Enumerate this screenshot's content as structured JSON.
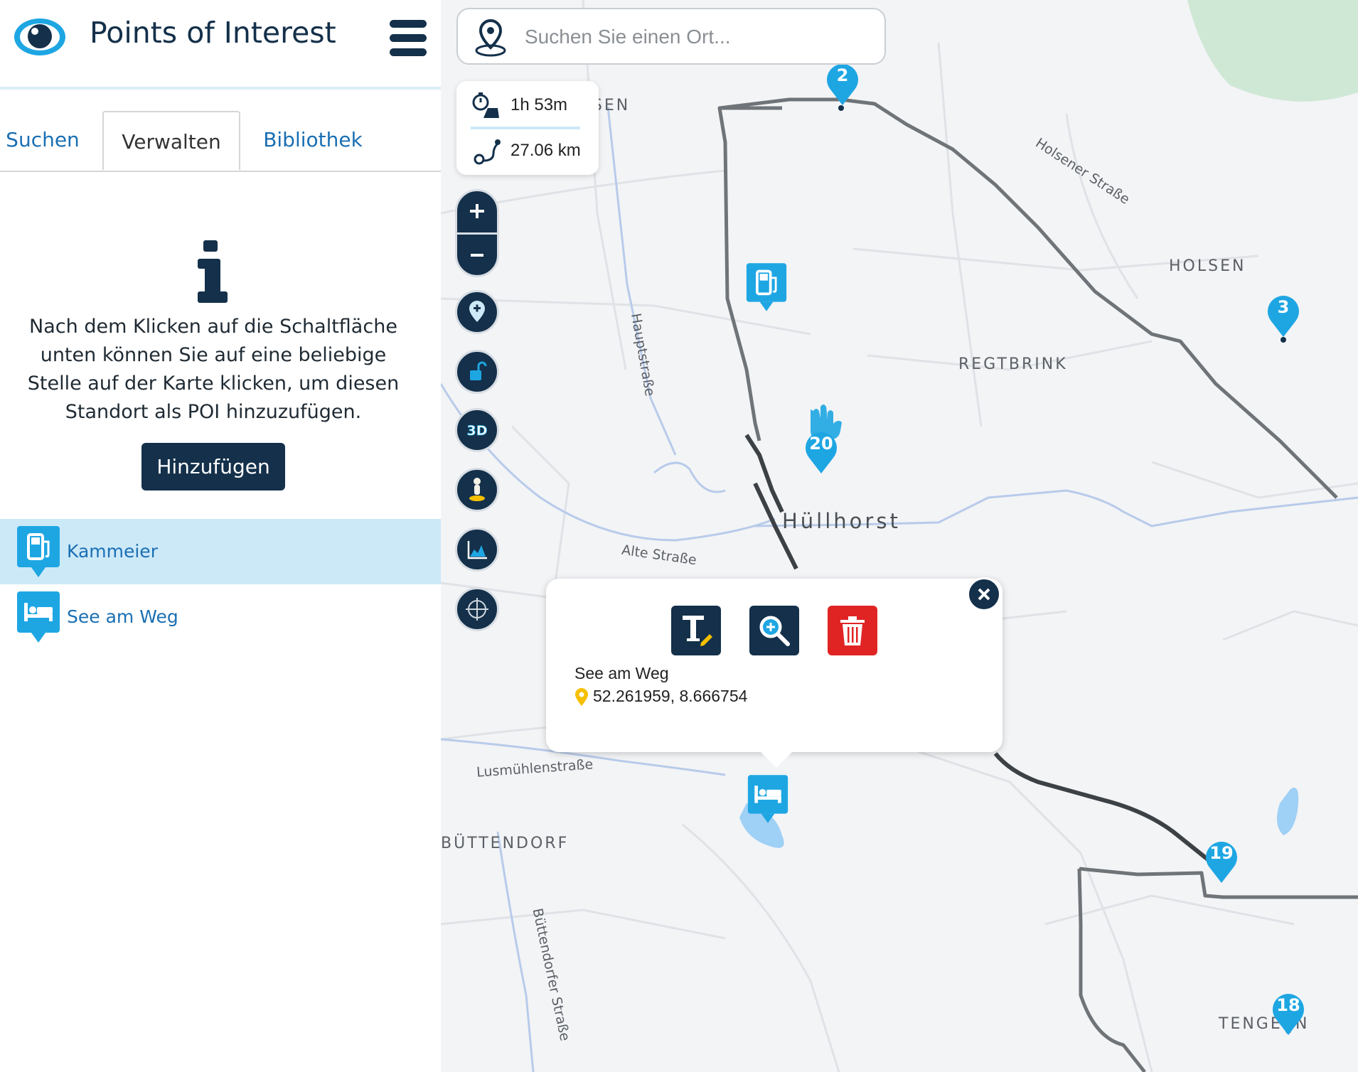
{
  "app": {
    "title": "Points of Interest"
  },
  "tabs": [
    {
      "label": "Suchen"
    },
    {
      "label": "Verwalten"
    },
    {
      "label": "Bibliothek"
    }
  ],
  "info": {
    "text": "Nach dem Klicken auf die Schaltfläche unten können Sie auf eine beliebige Stelle auf der Karte klicken, um diesen Standort als POI hinzuzufügen.",
    "add_label": "Hinzufügen"
  },
  "poi_list": [
    {
      "label": "Kammeier",
      "icon": "fuel-pump-icon",
      "selected": true
    },
    {
      "label": "See am Weg",
      "icon": "hotel-bed-icon",
      "selected": false
    }
  ],
  "search": {
    "placeholder": "Suchen Sie einen Ort..."
  },
  "route": {
    "duration": "1h 53m",
    "distance": "27.06 km"
  },
  "controls": [
    "zoom-in-icon",
    "zoom-out-icon",
    "add-poi-icon",
    "unlock-icon",
    "3d-icon",
    "street-view-icon",
    "elevation-chart-icon",
    "locate-crosshair-icon"
  ],
  "controls_labels": {
    "three_d": "3D"
  },
  "popup": {
    "name": "See am Weg",
    "coords": "52.261959, 8.666754",
    "actions": [
      "edit-text-icon",
      "zoom-to-icon",
      "trash-icon"
    ]
  },
  "map": {
    "places": [
      "AHLSEN",
      "HOLSEN",
      "REGTBRINK",
      "Hüllhorst",
      "BÜTTENDORF",
      "TENGERN"
    ],
    "streets": [
      "Holsener Straße",
      "Hauptstraße",
      "Alte Straße",
      "Lusmühlenstraße",
      "Büttendorfer Straße"
    ],
    "waypoints": [
      "2",
      "3",
      "20",
      "19",
      "18"
    ]
  },
  "colors": {
    "brand_dark": "#14304a",
    "accent_blue": "#1ea6e3",
    "delete_red": "#e02424",
    "route_gray": "#6f7479"
  }
}
